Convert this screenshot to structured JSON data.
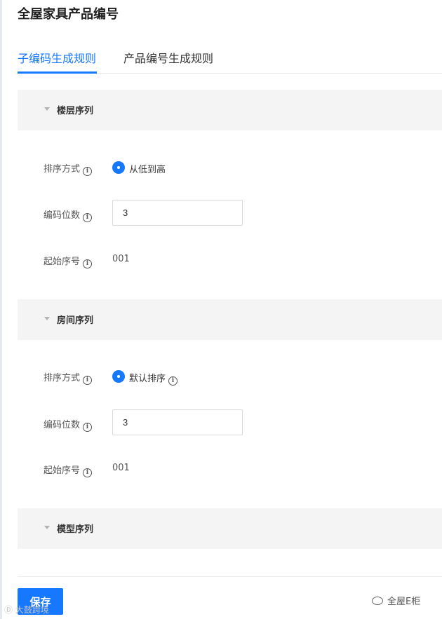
{
  "page": {
    "title": "全屋家具产品编号"
  },
  "tabs": [
    {
      "label": "子编码生成规则",
      "active": true
    },
    {
      "label": "产品编号生成规则",
      "active": false
    }
  ],
  "sections": [
    {
      "title": "楼层序列",
      "sort_label": "排序方式",
      "sort_option": "从低到高",
      "digits_label": "编码位数",
      "digits_value": "3",
      "start_label": "起始序号",
      "start_value": "001"
    },
    {
      "title": "房间序列",
      "sort_label": "排序方式",
      "sort_option": "默认排序",
      "digits_label": "编码位数",
      "digits_value": "3",
      "start_label": "起始序号",
      "start_value": "001"
    },
    {
      "title": "模型序列"
    }
  ],
  "footer": {
    "save_label": "保存"
  },
  "watermarks": {
    "left": "大鼓跨境",
    "right": "全屋E柜"
  },
  "colors": {
    "accent": "#1677ff",
    "section_bg": "#f4f4f4"
  }
}
